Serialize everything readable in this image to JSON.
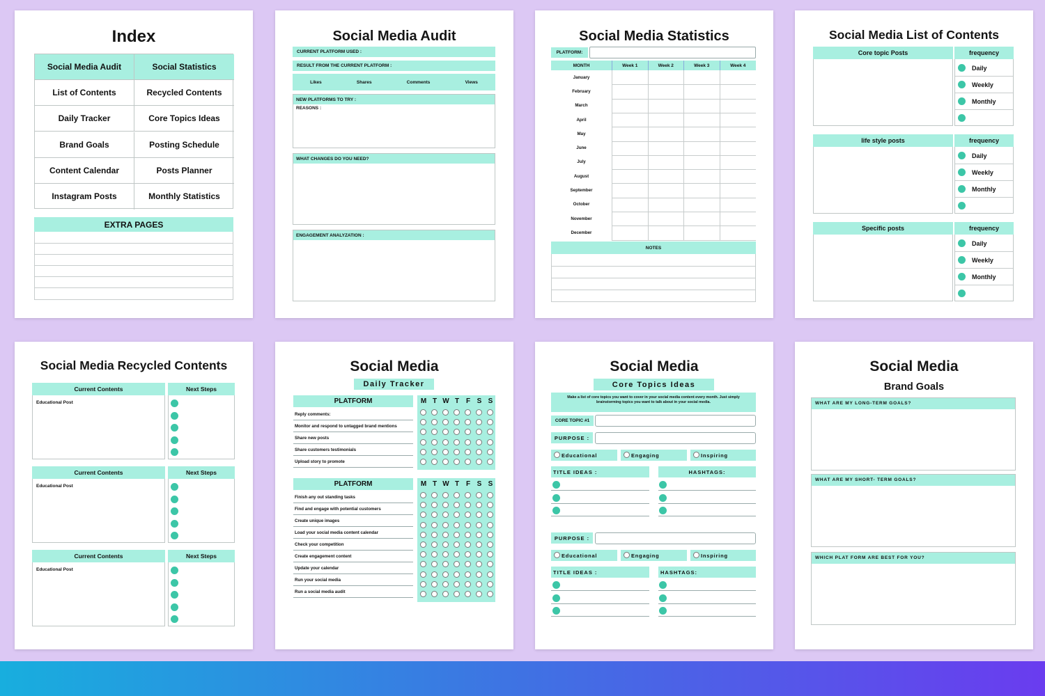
{
  "index": {
    "title": "Index",
    "rows": [
      [
        "Social Media Audit",
        "Social Statistics"
      ],
      [
        "List of Contents",
        "Recycled Contents"
      ],
      [
        "Daily Tracker",
        "Core Topics Ideas"
      ],
      [
        "Brand Goals",
        "Posting Schedule"
      ],
      [
        "Content Calendar",
        "Posts Planner"
      ],
      [
        "Instagram Posts",
        "Monthly Statistics"
      ]
    ],
    "extra": "EXTRA PAGES"
  },
  "audit": {
    "title": "Social Media Audit",
    "platform_used": "CURRENT PLATFORM USED :",
    "result": "RESULT FROM THE CURRENT PLATFORM :",
    "metrics": [
      "Likes",
      "Shares",
      "Comments",
      "Views"
    ],
    "new_platforms": "NEW PLATFORMS TO TRY :",
    "reasons": "REASONS :",
    "changes": "WHAT CHANGES DO YOU NEED?",
    "engagement": "ENGAGEMENT ANALYZATION :"
  },
  "stats": {
    "title": "Social Media Statistics",
    "platform": "PLATFORM:",
    "month_header": "MONTH",
    "weeks": [
      "Week 1",
      "Week 2",
      "Week 3",
      "Week 4"
    ],
    "months": [
      "January",
      "February",
      "March",
      "April",
      "May",
      "June",
      "July",
      "August",
      "September",
      "October",
      "November",
      "December"
    ],
    "notes": "NOTES"
  },
  "list": {
    "title": "Social Media List of Contents",
    "sections": [
      {
        "name": "Core topic Posts",
        "freq": "frequency"
      },
      {
        "name": "life style posts",
        "freq": "frequency"
      },
      {
        "name": "Specific posts",
        "freq": "frequency"
      }
    ],
    "options": [
      "Daily",
      "Weekly",
      "Monthly"
    ]
  },
  "recycled": {
    "title": "Social Media Recycled Contents",
    "current": "Current Contents",
    "next": "Next Steps",
    "post": "Educational Post"
  },
  "tracker": {
    "title": "Social Media",
    "subtitle": "Daily Tracker",
    "platform": "PLATFORM",
    "days": [
      "M",
      "T",
      "W",
      "T",
      "F",
      "S",
      "S"
    ],
    "tasks1": [
      "Reply comments:",
      "Monitor and respond to untagged brand mentions",
      "Share new posts",
      "Share customers testimonials",
      "Upload story to promote"
    ],
    "tasks2": [
      "Finish any out standing tasks",
      "Find and engage with potential customers",
      "Create unique images",
      "Load your social media content calendar",
      "Check your competition",
      "Create engagement content",
      "Update your calendar",
      "Run your social media",
      "Run a social media audit"
    ]
  },
  "core": {
    "title": "Social Media",
    "subtitle": "Core Topics Ideas",
    "intro": "Make a list of core topics you want to cover in your social media content every month. Just simply brainstorming topics you want to talk about in your social media.",
    "topic": "CORE TOPIC #1",
    "purpose": "PURPOSE :",
    "choices": [
      "Educational",
      "Engaging",
      "Inspiring"
    ],
    "title_ideas": "TITLE IDEAS :",
    "hashtags1": "HASHTAGS:",
    "hashtags2": "HASHTAGS:"
  },
  "brand": {
    "title": "Social Media",
    "subtitle": "Brand Goals",
    "q1": "WHAT ARE MY LONG-TERM GOALS?",
    "q2": "WHAT ARE MY SHORT- TERM GOALS?",
    "q3": "WHICH PLAT FORM ARE BEST FOR YOU?"
  }
}
